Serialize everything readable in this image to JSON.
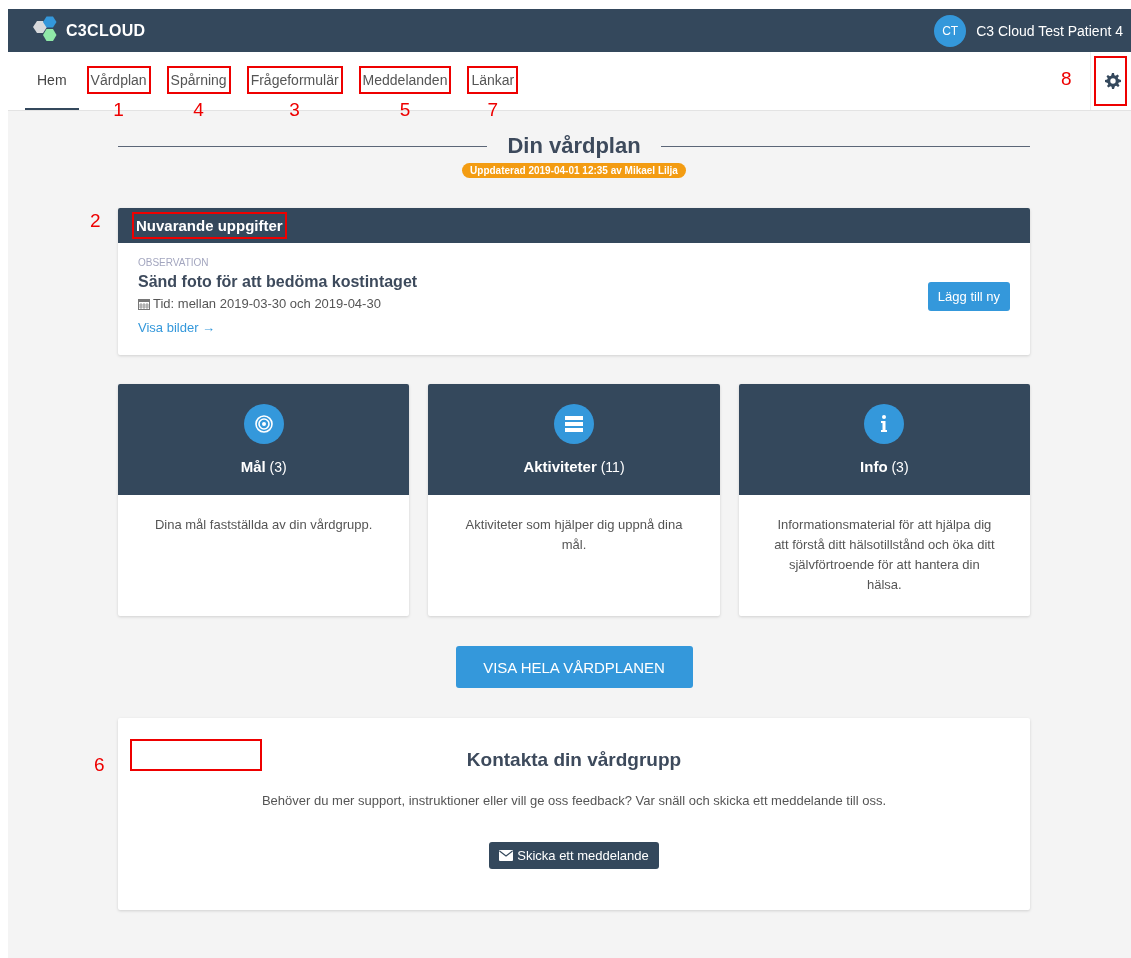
{
  "header": {
    "logo": "C3CLOUD",
    "user": {
      "initials": "CT",
      "name": "C3 Cloud Test Patient 4"
    }
  },
  "nav": {
    "tabs": [
      {
        "label": "Hem",
        "selected": true
      },
      {
        "label": "Vårdplan",
        "selected": false,
        "annotation": "1"
      },
      {
        "label": "Spårning",
        "selected": false,
        "annotation": "4"
      },
      {
        "label": "Frågeformulär",
        "selected": false,
        "annotation": "3"
      },
      {
        "label": "Meddelanden",
        "selected": false,
        "annotation": "5"
      },
      {
        "label": "Länkar",
        "selected": false,
        "annotation": "7"
      }
    ],
    "settings_annotation": "8"
  },
  "care_plan": {
    "title": "Din vårdplan",
    "updated_badge": "Uppdaterad 2019-04-01 12:35 av Mikael Lilja"
  },
  "current_tasks": {
    "title": "Nuvarande uppgifter",
    "annotation": "2",
    "tasks": [
      {
        "category": "OBSERVATION",
        "title": "Sänd foto för att bedöma kostintaget",
        "time": "Tid: mellan 2019-03-30 och 2019-04-30",
        "link": "Visa bilder →"
      }
    ],
    "add_button": "Lägg till ny"
  },
  "summary_cards": [
    {
      "kind": "goals",
      "title": "Mål",
      "count": "(3)",
      "description": "Dina mål fastställda av din vårdgrupp."
    },
    {
      "kind": "activities",
      "title": "Aktiviteter",
      "count": "(11)",
      "description": "Aktiviteter som hjälper dig uppnå dina mål."
    },
    {
      "kind": "info",
      "title": "Info",
      "count": "(3)",
      "description": "Informationsmaterial för att hjälpa dig att förstå ditt hälsotillstånd och öka ditt självförtroende för att hantera din hälsa."
    }
  ],
  "view_all_button": "VISA HELA VÅRDPLANEN",
  "contact": {
    "annotation": "6",
    "title": "Kontakta din vårdgrupp",
    "text": "Behöver du mer support, instruktioner eller vill ge oss feedback? Var snäll och skicka ett meddelande till oss.",
    "button": "Skicka ett meddelande"
  }
}
